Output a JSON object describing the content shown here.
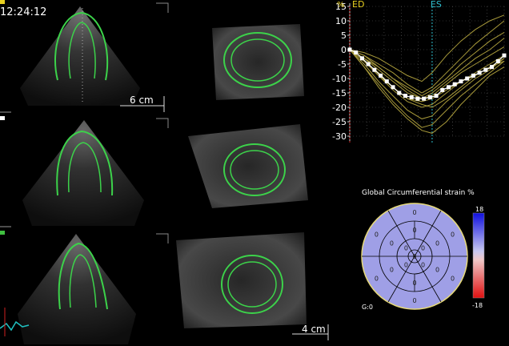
{
  "header": {
    "time": "12:24:12"
  },
  "scales": {
    "top": "6 cm",
    "bottom": "4 cm"
  },
  "strain_panel": {
    "title": "Global Circumferential strain %",
    "colorbar_max": "18",
    "colorbar_min": "-18",
    "g_label": "G:0",
    "segment_value": "0"
  },
  "chart_data": {
    "type": "line",
    "ylabel": "%",
    "ylim": [
      -30,
      15
    ],
    "yticks": [
      15,
      10,
      5,
      0,
      -5,
      -10,
      -15,
      -20,
      -25,
      -30
    ],
    "markers": [
      {
        "label": "ED",
        "x": 0
      },
      {
        "label": "ES",
        "x": 40
      }
    ],
    "xlim": [
      0,
      75
    ],
    "colors": {
      "series": "#a89a3a",
      "average": "#ffffff",
      "es_line": "#30c0d0",
      "ed_line": "#d02020",
      "axis": "#c8c8c8"
    },
    "series": [
      {
        "values": [
          [
            0,
            0
          ],
          [
            7,
            -4
          ],
          [
            14,
            -9
          ],
          [
            21,
            -14
          ],
          [
            28,
            -18
          ],
          [
            35,
            -20
          ],
          [
            40,
            -19
          ],
          [
            47,
            -15
          ],
          [
            54,
            -11
          ],
          [
            61,
            -8
          ],
          [
            68,
            -5
          ],
          [
            75,
            -2
          ]
        ]
      },
      {
        "values": [
          [
            0,
            0
          ],
          [
            7,
            -6
          ],
          [
            14,
            -12
          ],
          [
            21,
            -18
          ],
          [
            28,
            -23
          ],
          [
            35,
            -27
          ],
          [
            40,
            -26
          ],
          [
            47,
            -21
          ],
          [
            54,
            -16
          ],
          [
            61,
            -12
          ],
          [
            68,
            -8
          ],
          [
            75,
            -4
          ]
        ]
      },
      {
        "values": [
          [
            0,
            0
          ],
          [
            7,
            -3
          ],
          [
            14,
            -6
          ],
          [
            21,
            -10
          ],
          [
            28,
            -14
          ],
          [
            35,
            -17
          ],
          [
            40,
            -16
          ],
          [
            47,
            -12
          ],
          [
            54,
            -8
          ],
          [
            61,
            -5
          ],
          [
            68,
            -2
          ],
          [
            75,
            1
          ]
        ]
      },
      {
        "values": [
          [
            0,
            0
          ],
          [
            7,
            -2
          ],
          [
            14,
            -5
          ],
          [
            21,
            -8
          ],
          [
            28,
            -12
          ],
          [
            35,
            -15
          ],
          [
            40,
            -13
          ],
          [
            47,
            -8
          ],
          [
            54,
            -3
          ],
          [
            61,
            2
          ],
          [
            68,
            6
          ],
          [
            75,
            10
          ]
        ]
      },
      {
        "values": [
          [
            0,
            0
          ],
          [
            7,
            -1
          ],
          [
            14,
            -3
          ],
          [
            21,
            -6
          ],
          [
            28,
            -9
          ],
          [
            35,
            -11
          ],
          [
            40,
            -8
          ],
          [
            47,
            -2
          ],
          [
            54,
            3
          ],
          [
            61,
            7
          ],
          [
            68,
            10
          ],
          [
            75,
            12
          ]
        ]
      },
      {
        "values": [
          [
            0,
            0
          ],
          [
            7,
            -5
          ],
          [
            14,
            -11
          ],
          [
            21,
            -16
          ],
          [
            28,
            -21
          ],
          [
            35,
            -24
          ],
          [
            40,
            -23
          ],
          [
            47,
            -18
          ],
          [
            54,
            -14
          ],
          [
            61,
            -10
          ],
          [
            68,
            -7
          ],
          [
            75,
            -3
          ]
        ]
      },
      {
        "values": [
          [
            0,
            0
          ],
          [
            7,
            -4
          ],
          [
            14,
            -8
          ],
          [
            21,
            -13
          ],
          [
            28,
            -17
          ],
          [
            35,
            -19
          ],
          [
            40,
            -20
          ],
          [
            47,
            -17
          ],
          [
            54,
            -13
          ],
          [
            61,
            -9
          ],
          [
            68,
            -6
          ],
          [
            75,
            -3
          ]
        ]
      },
      {
        "values": [
          [
            0,
            0
          ],
          [
            7,
            -3
          ],
          [
            14,
            -7
          ],
          [
            21,
            -11
          ],
          [
            28,
            -15
          ],
          [
            35,
            -17
          ],
          [
            40,
            -15
          ],
          [
            47,
            -11
          ],
          [
            54,
            -7
          ],
          [
            61,
            -3
          ],
          [
            68,
            0
          ],
          [
            75,
            4
          ]
        ]
      },
      {
        "values": [
          [
            0,
            0
          ],
          [
            7,
            -6
          ],
          [
            14,
            -13
          ],
          [
            21,
            -19
          ],
          [
            28,
            -24
          ],
          [
            35,
            -28
          ],
          [
            40,
            -29
          ],
          [
            47,
            -25
          ],
          [
            54,
            -19
          ],
          [
            61,
            -14
          ],
          [
            68,
            -9
          ],
          [
            75,
            -6
          ]
        ]
      },
      {
        "values": [
          [
            0,
            0
          ],
          [
            7,
            -2
          ],
          [
            14,
            -6
          ],
          [
            21,
            -10
          ],
          [
            28,
            -13
          ],
          [
            35,
            -16
          ],
          [
            40,
            -14
          ],
          [
            47,
            -10
          ],
          [
            54,
            -5
          ],
          [
            61,
            -1
          ],
          [
            68,
            3
          ],
          [
            75,
            6
          ]
        ]
      },
      {
        "values": [
          [
            0,
            0
          ],
          [
            7,
            -4
          ],
          [
            14,
            -9
          ],
          [
            21,
            -13
          ],
          [
            28,
            -17
          ],
          [
            35,
            -18
          ],
          [
            40,
            -17
          ],
          [
            47,
            -14
          ],
          [
            54,
            -11
          ],
          [
            61,
            -9
          ],
          [
            68,
            -6
          ],
          [
            75,
            -4
          ]
        ]
      }
    ],
    "average": {
      "values": [
        [
          0,
          0
        ],
        [
          3,
          -1
        ],
        [
          6,
          -3
        ],
        [
          9,
          -5
        ],
        [
          12,
          -7
        ],
        [
          15,
          -9
        ],
        [
          18,
          -11
        ],
        [
          21,
          -13
        ],
        [
          24,
          -15
        ],
        [
          27,
          -16
        ],
        [
          30,
          -16.5
        ],
        [
          33,
          -17
        ],
        [
          36,
          -17
        ],
        [
          39,
          -16.5
        ],
        [
          42,
          -16
        ],
        [
          45,
          -14
        ],
        [
          48,
          -13
        ],
        [
          51,
          -12
        ],
        [
          54,
          -11
        ],
        [
          57,
          -10
        ],
        [
          60,
          -9
        ],
        [
          63,
          -8
        ],
        [
          66,
          -7
        ],
        [
          69,
          -6
        ],
        [
          72,
          -4
        ],
        [
          75,
          -2
        ]
      ]
    }
  }
}
